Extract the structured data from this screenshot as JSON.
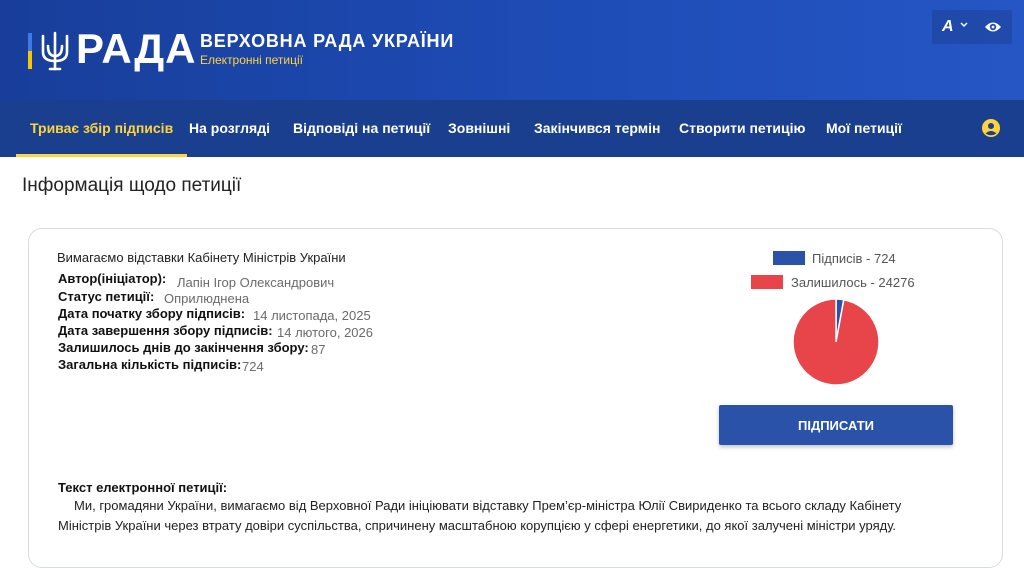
{
  "header": {
    "logo_text": "РАДА",
    "org_name": "ВЕРХОВНА РАДА УКРАЇНИ",
    "org_subtitle": "Електронні петиції",
    "font_size_label": "A",
    "colors": {
      "header_blue": "#1e4cb6",
      "nav_blue": "#1b3f8f",
      "accent_yellow": "#ffd43b"
    }
  },
  "nav": {
    "items": [
      {
        "label": "Триває збір підписів",
        "active": true
      },
      {
        "label": "На розгляді"
      },
      {
        "label": "Відповіді на петиції"
      },
      {
        "label": "Зовнішні"
      },
      {
        "label": "Закінчився термін"
      },
      {
        "label": "Створити петицію"
      },
      {
        "label": "Мої петиції"
      }
    ],
    "user_icon": "user-circle-icon"
  },
  "page": {
    "title": "Інформація щодо петиції"
  },
  "petition": {
    "title": "Вимагаємо відставки Кабінету Міністрів України",
    "fields": [
      {
        "label": "Автор(ініціатор):",
        "value": "Лапін Ігор Олександрович"
      },
      {
        "label": "Статус петиції:",
        "value": "Оприлюднена"
      },
      {
        "label": "Дата початку збору підписів:",
        "value": "14 листопада, 2025"
      },
      {
        "label": "Дата завершення збору підписів:",
        "value": "14 лютого, 2026"
      },
      {
        "label": "Залишилось днів до закінчення збору:",
        "value": "87"
      },
      {
        "label": "Загальна кількість підписів:",
        "value": "724"
      }
    ],
    "sign_button": "ПІДПИСАТИ",
    "text_header": "Текст електронної петиції:",
    "text": "Ми, громадяни України, вимагаємо від Верховної Ради ініціювати відставку Прем’єр-міністра Юлії Свириденко та всього складу Кабінету Міністрів України через втрату довіри суспільства, спричинену масштабною корупцією у сфері енергетики, до якої залучені міністри уряду."
  },
  "chart_data": {
    "type": "pie",
    "legend": [
      "Підписів - 724",
      "Залишилось - 24276"
    ],
    "series": [
      {
        "value": 724,
        "color": "#2a52a8"
      },
      {
        "value": 24276,
        "color": "#e8454a"
      }
    ]
  }
}
